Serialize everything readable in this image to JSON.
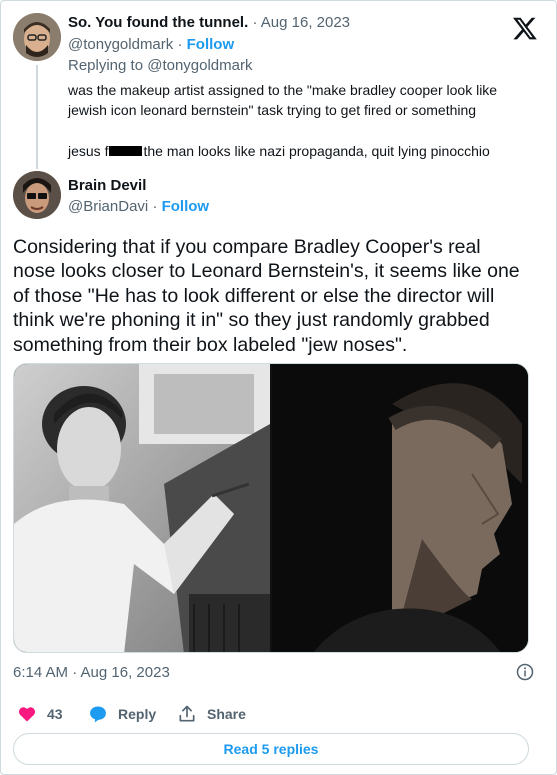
{
  "parent_tweet": {
    "display_name": "So. You found the tunnel.",
    "date": "Aug 16, 2023",
    "handle": "@tonygoldmark",
    "follow_label": "Follow",
    "replying_to": "Replying to @tonygoldmark",
    "line1": "was the makeup artist assigned to the \"make bradley cooper look like",
    "line2": "jewish icon leonard bernstein\" task trying to get fired or something",
    "line3_start": "jesus f",
    "line3_end": "the man looks like nazi propaganda, quit lying pinocchio"
  },
  "reply_tweet": {
    "display_name": "Brain Devil",
    "handle": "@BrianDavi",
    "follow_label": "Follow",
    "text_lines": [
      "Considering that if you compare Bradley Cooper's real",
      "nose looks closer to Leonard Bernstein's, it seems like one",
      "of those \"He has to look different or else the director will",
      "think we're phoning it in\" so they just randomly grabbed",
      "something from their box labeled \"jew noses\"."
    ],
    "timestamp": "6:14 AM · Aug 16, 2023",
    "likes_count": "43",
    "reply_label": "Reply",
    "share_label": "Share",
    "read_replies_label": "Read 5 replies"
  },
  "colors": {
    "accent": "#1d9bf0",
    "like": "#f91880",
    "muted_text": "#536471",
    "border": "#cfd9de"
  },
  "icons": [
    "x-logo-icon",
    "heart-icon",
    "reply-bubble-icon",
    "share-icon",
    "info-icon"
  ]
}
